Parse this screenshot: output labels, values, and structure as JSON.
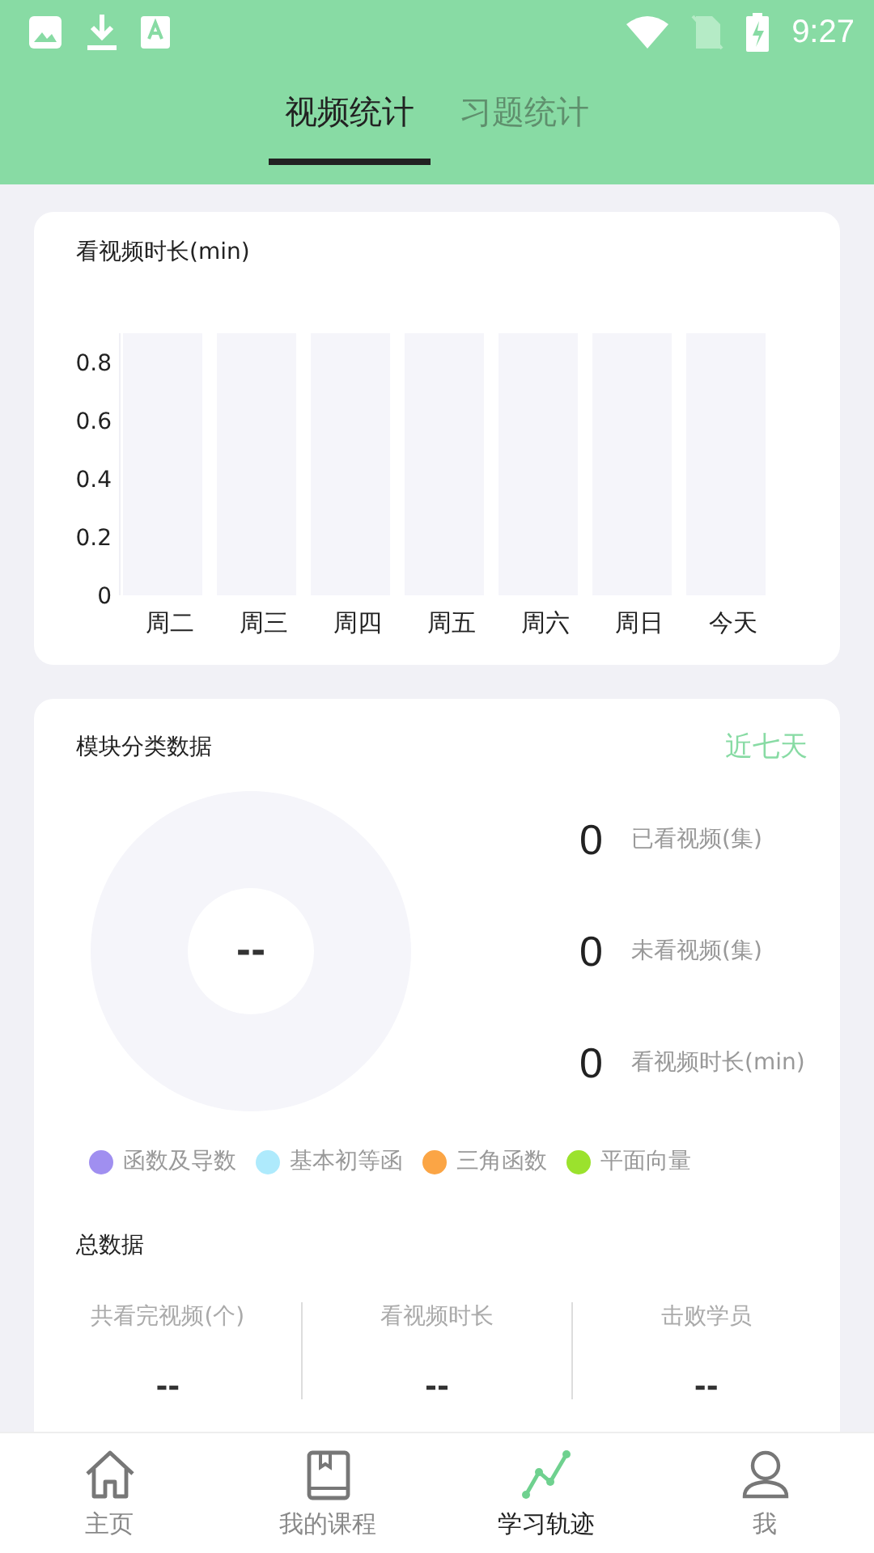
{
  "status_bar": {
    "time": "9:27"
  },
  "tabs": [
    {
      "label": "视频统计",
      "selected": true
    },
    {
      "label": "习题统计",
      "selected": false
    }
  ],
  "watch_card": {
    "title": "看视频时长(min)",
    "chart_data": {
      "type": "bar",
      "categories": [
        "周二",
        "周三",
        "周四",
        "周五",
        "周六",
        "周日",
        "今天"
      ],
      "values": [
        0,
        0,
        0,
        0,
        0,
        0,
        0
      ],
      "ylim": [
        0,
        0.9
      ],
      "yticks": [
        0,
        0.2,
        0.4,
        0.6,
        0.8
      ]
    }
  },
  "module_card": {
    "title": "模块分类数据",
    "range": "近七天",
    "center_value": "--",
    "stats": [
      {
        "value": "0",
        "label": "已看视频(集)"
      },
      {
        "value": "0",
        "label": "未看视频(集)"
      },
      {
        "value": "0",
        "label": "看视频时长(min)"
      }
    ],
    "legend": [
      {
        "label": "函数及导数",
        "color": "#a08ff0"
      },
      {
        "label": "基本初等函",
        "color": "#aeeafc"
      },
      {
        "label": "三角函数",
        "color": "#fba545"
      },
      {
        "label": "平面向量",
        "color": "#9be22d"
      }
    ]
  },
  "totals": {
    "title": "总数据",
    "columns": [
      {
        "label": "共看完视频(个)",
        "value": "--"
      },
      {
        "label": "看视频时长",
        "value": "--"
      },
      {
        "label": "击败学员",
        "value": "--"
      }
    ]
  },
  "bottom_nav": [
    {
      "label": "主页",
      "kind": "home",
      "selected": false
    },
    {
      "label": "我的课程",
      "kind": "book",
      "selected": false
    },
    {
      "label": "学习轨迹",
      "kind": "track",
      "selected": true
    },
    {
      "label": "我",
      "kind": "person",
      "selected": false
    }
  ]
}
